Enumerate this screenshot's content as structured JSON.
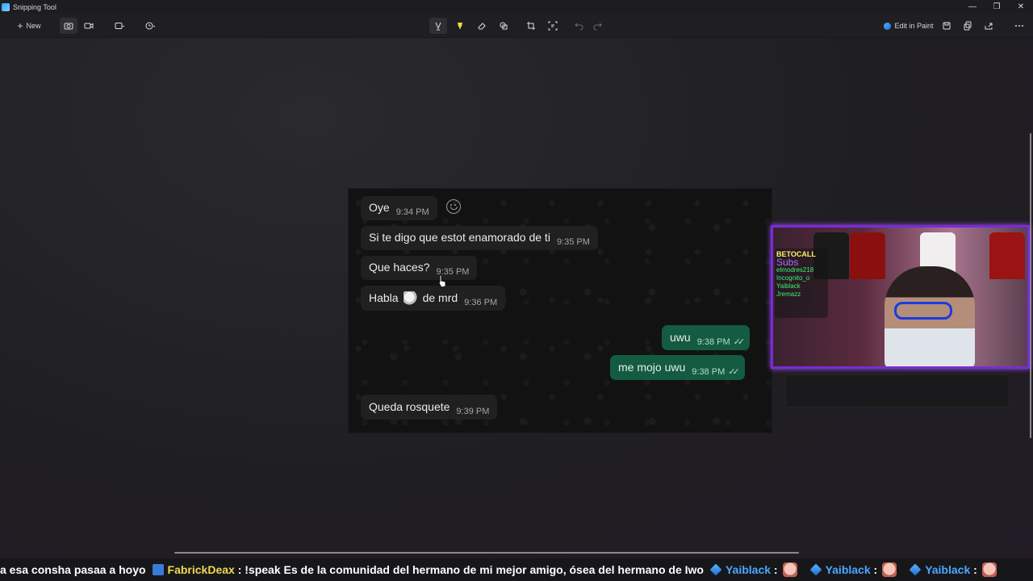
{
  "window": {
    "title": "Snipping Tool"
  },
  "toolbar": {
    "new_label": "New",
    "edit_in_paint_label": "Edit in Paint"
  },
  "chat": {
    "messages": [
      {
        "direction": "in",
        "text": "Oye",
        "time": "9:34 PM"
      },
      {
        "direction": "in",
        "text": "Si te digo que estot enamorado de ti",
        "time": "9:35 PM"
      },
      {
        "direction": "in",
        "text": "Que haces?",
        "time": "9:35 PM"
      },
      {
        "direction": "in",
        "text_before": "Habla",
        "text_after": "de mrd",
        "time": "9:36 PM"
      },
      {
        "direction": "out",
        "text": "uwu",
        "time": "9:38 PM"
      },
      {
        "direction": "out",
        "text": "me mojo uwu",
        "time": "9:38 PM"
      },
      {
        "direction": "in",
        "text": "Queda rosquete",
        "time": "9:39 PM"
      }
    ]
  },
  "webcam": {
    "overlay_lines": [
      "BETOCALL",
      "Subs",
      "elmodres218",
      "Incognito_o",
      "Yaiblack",
      "Jremazz"
    ]
  },
  "ticker": {
    "lead_text": "a esa consha pasaa a hoyo",
    "entries": [
      {
        "user": "FabrickDeax",
        "message": ": !speak Es de la comunidad del hermano de mi mejor amigo, ósea del hermano de Iwo"
      },
      {
        "user": "Yaiblack",
        "message": ":"
      },
      {
        "user": "Yaiblack",
        "message": ":"
      },
      {
        "user": "Yaiblack",
        "message": ":"
      }
    ]
  }
}
